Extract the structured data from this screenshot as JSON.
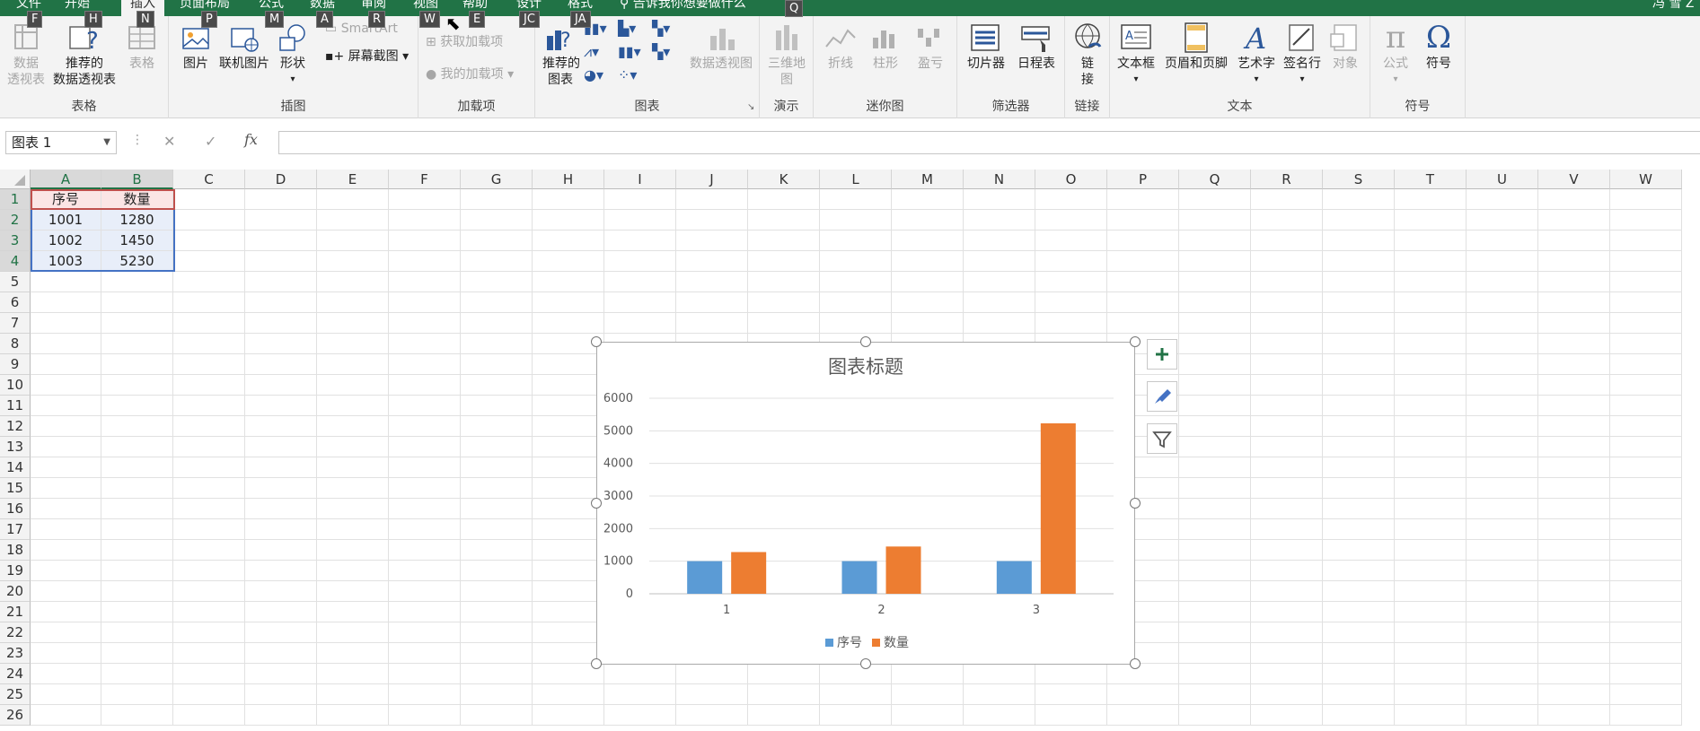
{
  "menu_tabs": [
    "文件",
    "开始",
    "插入",
    "页面布局",
    "公式",
    "数据",
    "审阅",
    "视图",
    "帮助",
    "设计",
    "格式"
  ],
  "tell_me": "告诉我你想要做什么",
  "user_name": "冯 雪 Z",
  "keytips": [
    "F",
    "H",
    "N",
    "P",
    "M",
    "A",
    "R",
    "W",
    "E",
    "JC",
    "JA",
    "Q"
  ],
  "ribbon": {
    "pivot_label": "数据\n透视表",
    "rec_pivot_label": "推荐的\n数据透视表",
    "table_label": "表格",
    "group_tables": "表格",
    "picture_label": "图片",
    "online_picture_label": "联机图片",
    "shapes_label": "形状",
    "smartart_label": "SmartArt",
    "screenshot_label": "屏幕截图",
    "group_illustrations": "插图",
    "get_addins_label": "获取加载项",
    "my_addins_label": "我的加载项",
    "group_addins": "加载项",
    "rec_charts_label": "推荐的\n图表",
    "pivot_chart_label": "数据透视图",
    "group_charts": "图表",
    "map3d_label": "三维地\n图",
    "group_tours": "演示",
    "spark_line_label": "折线",
    "spark_column_label": "柱形",
    "spark_winloss_label": "盈亏",
    "group_sparklines": "迷你图",
    "slicer_label": "切片器",
    "timeline_label": "日程表",
    "group_filters": "筛选器",
    "link_label": "链\n接",
    "group_links": "链接",
    "textbox_label": "文本框",
    "header_footer_label": "页眉和页脚",
    "wordart_label": "艺术字",
    "signature_label": "签名行",
    "object_label": "对象",
    "group_text": "文本",
    "equation_label": "公式",
    "symbol_label": "符号",
    "group_symbols": "符号",
    "accent_color": "#217346"
  },
  "formula_bar": {
    "name_box": "图表 1",
    "cancel_icon": "✕",
    "enter_icon": "✓",
    "fx": "fx",
    "value": ""
  },
  "columns": [
    "A",
    "B",
    "C",
    "D",
    "E",
    "F",
    "G",
    "H",
    "I",
    "J",
    "K",
    "L",
    "M",
    "N",
    "O",
    "P",
    "Q",
    "R",
    "S",
    "T",
    "U",
    "V",
    "W"
  ],
  "rows": [
    "1",
    "2",
    "3",
    "4",
    "5",
    "6",
    "7",
    "8",
    "9",
    "10",
    "11",
    "12",
    "13",
    "14",
    "15",
    "16",
    "17",
    "18",
    "19",
    "20",
    "21",
    "22",
    "23",
    "24",
    "25",
    "26"
  ],
  "cells": {
    "A1": "序号",
    "B1": "数量",
    "A2": "1001",
    "B2": "1280",
    "A3": "1002",
    "B3": "1450",
    "A4": "1003",
    "B4": "5230"
  },
  "chart_data": {
    "type": "bar",
    "title": "图表标题",
    "categories": [
      "1",
      "2",
      "3"
    ],
    "series": [
      {
        "name": "序号",
        "values": [
          1001,
          1002,
          1003
        ],
        "color": "#5b9bd5"
      },
      {
        "name": "数量",
        "values": [
          1280,
          1450,
          5230
        ],
        "color": "#ed7d31"
      }
    ],
    "ylim": [
      0,
      6000
    ],
    "yticks": [
      "0",
      "1000",
      "2000",
      "3000",
      "4000",
      "5000",
      "6000"
    ],
    "grid": true,
    "legend": "bottom"
  },
  "chart_side_buttons": [
    "plus-icon",
    "brush-icon",
    "filter-icon"
  ]
}
